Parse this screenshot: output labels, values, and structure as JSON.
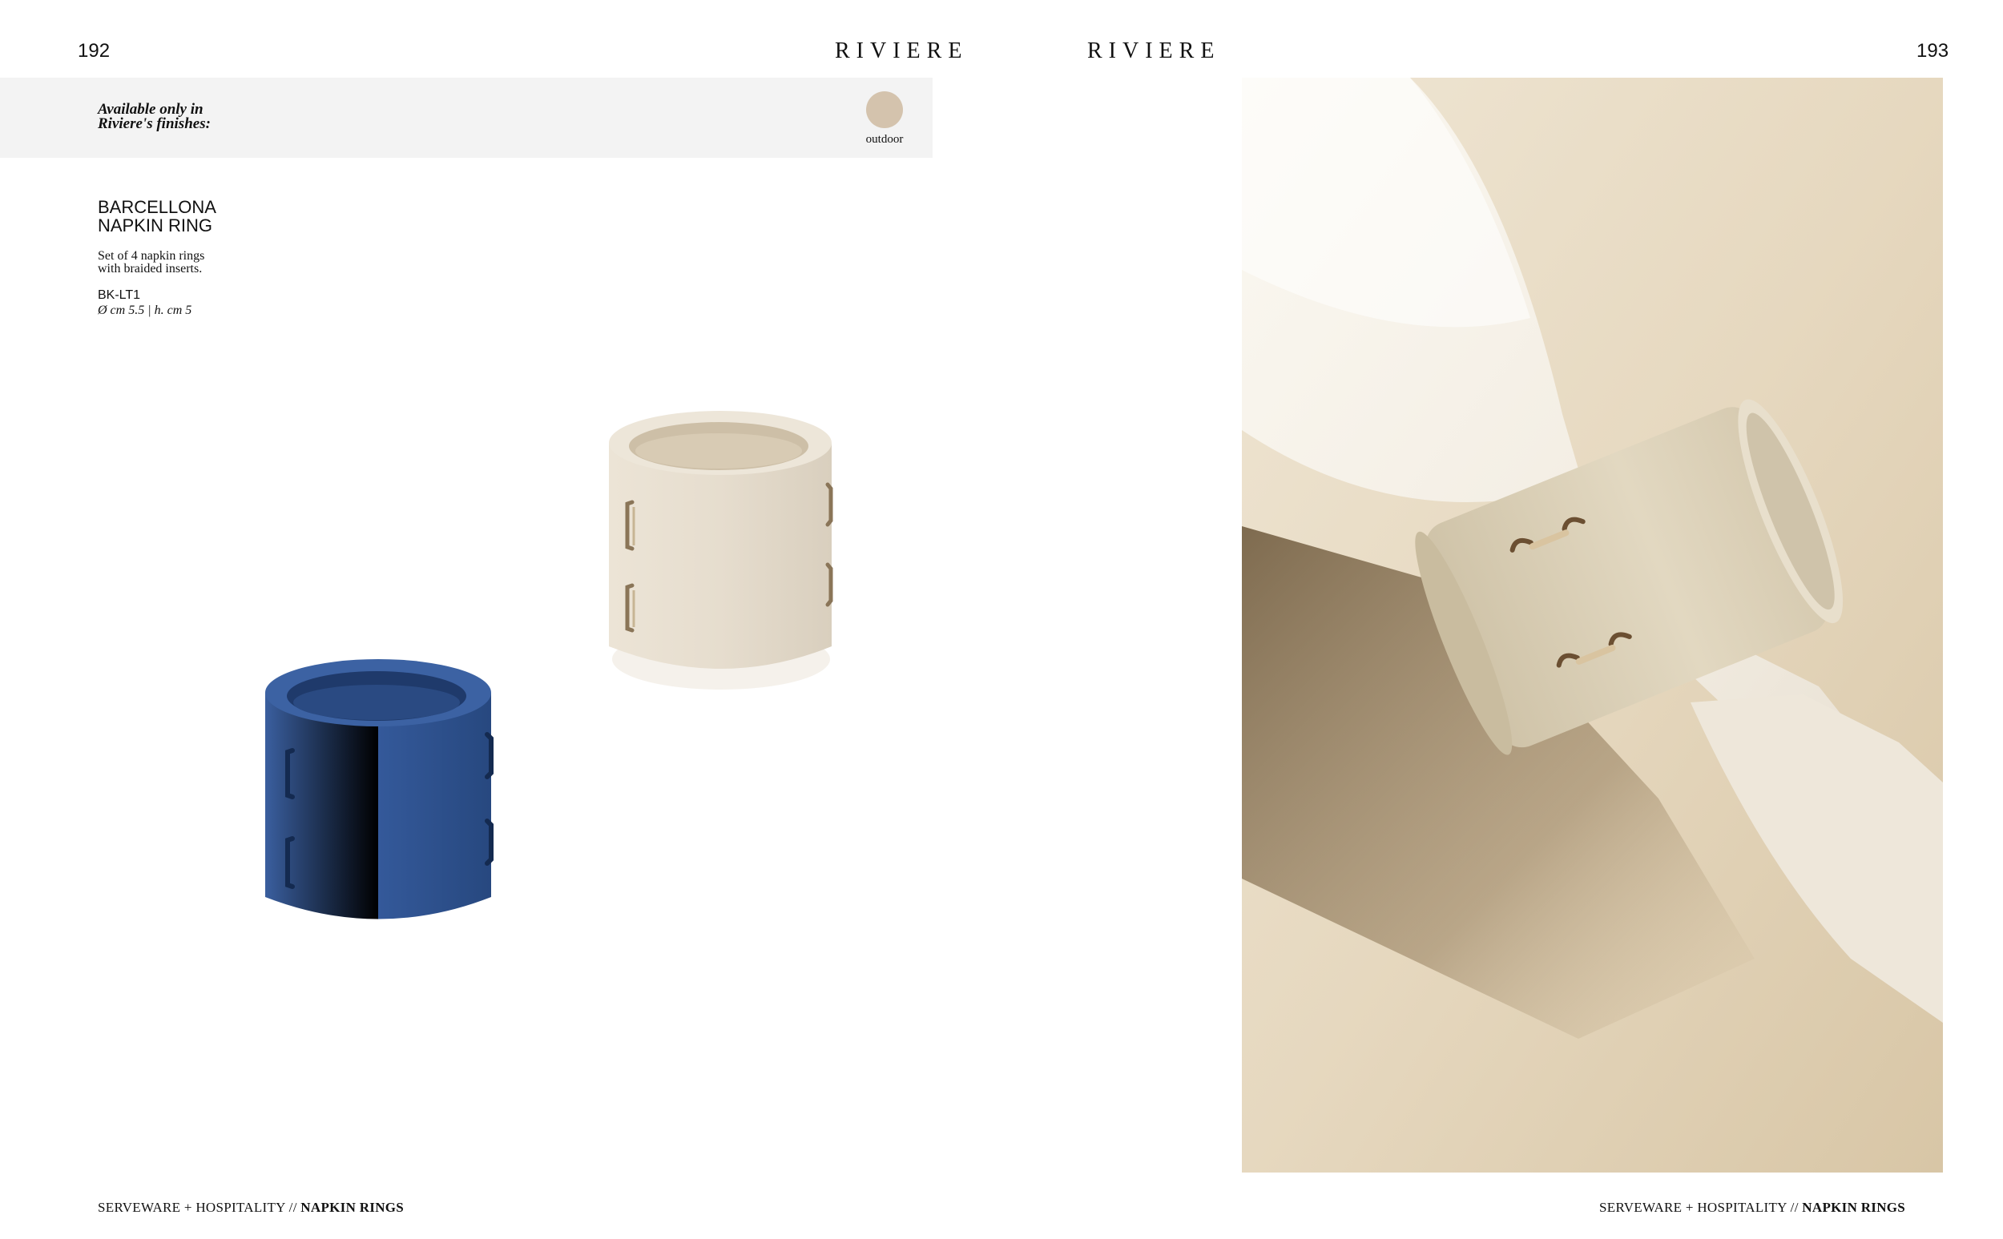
{
  "left_page": {
    "page_number": "192",
    "brand": "RIVIERE",
    "finish_bar": {
      "label_line1": "Available only in",
      "label_line2": "Riviere's finishes:",
      "swatch_label": "outdoor",
      "swatch_color": "#d4c3ad"
    },
    "product": {
      "name_line1": "BARCELLONA",
      "name_line2": "NAPKIN RING",
      "desc_line1": "Set of 4 napkin rings",
      "desc_line2": "with braided inserts.",
      "code": "BK-LT1",
      "dimensions": "Ø cm 5.5 | h. cm 5"
    },
    "images": [
      {
        "icon": "napkin-ring-beige",
        "color": "#e5dccd"
      },
      {
        "icon": "napkin-ring-blue",
        "color": "#2b4f8f"
      }
    ],
    "footer": {
      "category": "SERVEWARE + HOSPITALITY //",
      "section": "NAPKIN RINGS"
    }
  },
  "right_page": {
    "page_number": "193",
    "brand": "RIVIERE",
    "photo": {
      "icon": "napkin-with-ring-photo",
      "background": "#e8dcc6"
    },
    "footer": {
      "category": "SERVEWARE + HOSPITALITY //",
      "section": "NAPKIN RINGS"
    }
  }
}
